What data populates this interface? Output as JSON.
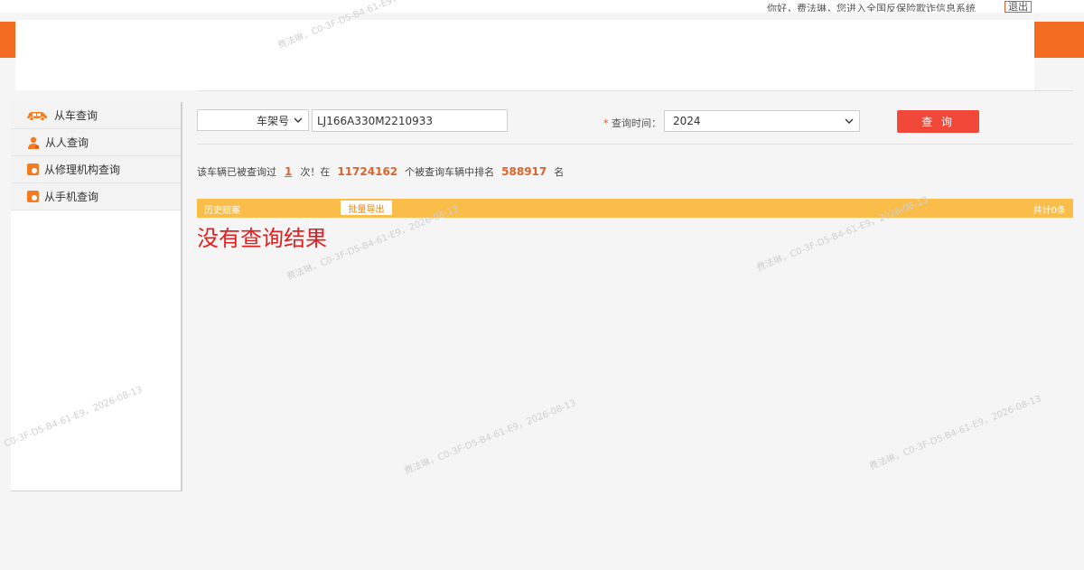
{
  "topbar": {
    "text": "你好，费法琳，您进入全国反保险欺诈信息系统",
    "logout_label": "退出"
  },
  "sidebar": {
    "items": [
      {
        "label": "从车查询",
        "icon": "car-icon"
      },
      {
        "label": "从人查询",
        "icon": "person-icon"
      },
      {
        "label": "从修理机构查询",
        "icon": "repair-shop-icon"
      },
      {
        "label": "从手机查询",
        "icon": "phone-icon"
      }
    ]
  },
  "search": {
    "type_label": "车架号",
    "vin_value": "LJ166A330M2210933",
    "time_star": "*",
    "time_label": "查询时间：",
    "year_value": "2024",
    "query_button": "查 询"
  },
  "stats": {
    "prefix": "该车辆已被查询过",
    "times": "1",
    "mid": "次！在",
    "total_cars": "11724162",
    "mid2": "个被查询车辆中排名",
    "rank": "588917",
    "suffix": "名"
  },
  "history": {
    "title": "历史赔案",
    "export_label": "批量导出",
    "total_label": "共计0条"
  },
  "result": {
    "message": "没有查询结果"
  },
  "watermark": {
    "text": "费法琳，C0-3F-D5-B4-61-E9，2026-08-13"
  },
  "colors": {
    "brand_orange": "#f36c22",
    "button_red": "#f2483a",
    "history_bar": "#fbbd4a",
    "no_result_red": "#e41d1d"
  }
}
